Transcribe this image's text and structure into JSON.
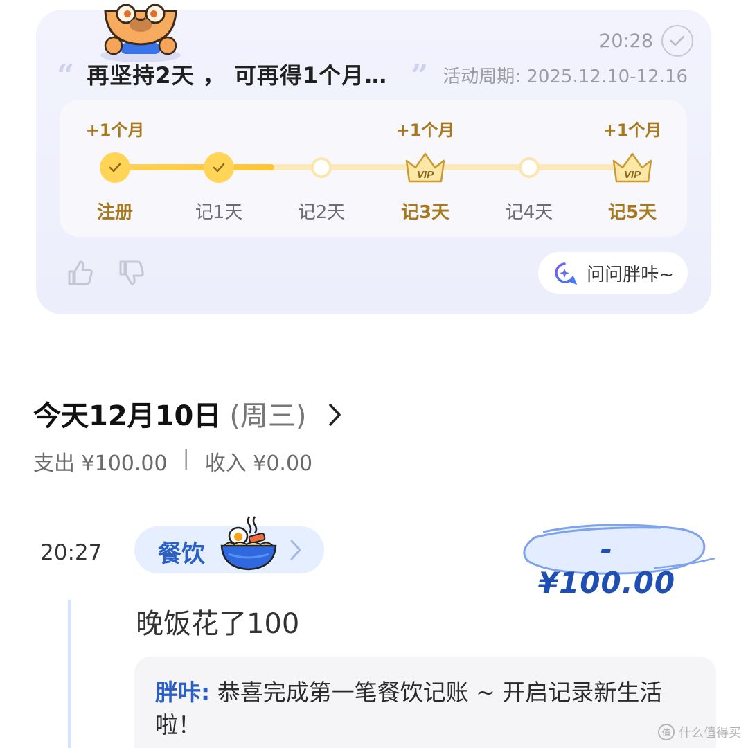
{
  "bot_card": {
    "time": "20:28",
    "message": "再坚持2天 ， 可再得1个月…",
    "period": "活动周期: 2025.12.10-12.16",
    "steps": [
      {
        "label": "注册",
        "reward": "+1个月",
        "state": "done"
      },
      {
        "label": "记1天",
        "reward": "",
        "state": "done"
      },
      {
        "label": "记2天",
        "reward": "",
        "state": "pending"
      },
      {
        "label": "记3天",
        "reward": "+1个月",
        "state": "vip"
      },
      {
        "label": "记4天",
        "reward": "",
        "state": "pending"
      },
      {
        "label": "记5天",
        "reward": "+1个月",
        "state": "vip"
      }
    ],
    "vip_badge": "VIP",
    "ask_label": "问问胖咔~"
  },
  "day": {
    "title": "今天12月10日",
    "weekday": "(周三)",
    "expense": "支出 ¥100.00",
    "divider": "|",
    "income": "收入 ¥0.00"
  },
  "record": {
    "time": "20:27",
    "category": "餐饮",
    "amount": "-¥100.00",
    "note": "晚饭花了100",
    "reply_name": "胖咔:",
    "reply_text": " 恭喜完成第一笔餐饮记账 ~ 开启记录新生活啦！"
  },
  "watermark": {
    "text": "什么值得买",
    "logo": "值"
  },
  "colors": {
    "accent_blue": "#2a5fc6",
    "gold": "#a7791e",
    "progress_yellow": "#ffd457",
    "card_bg": "#eef0fc"
  },
  "icons": [
    "mascot-capybara",
    "check-icon",
    "thumbs-up-icon",
    "thumbs-down-icon",
    "sparkle-chat-icon",
    "chevron-right-icon",
    "noodle-bowl-icon",
    "vip-crown-icon"
  ]
}
